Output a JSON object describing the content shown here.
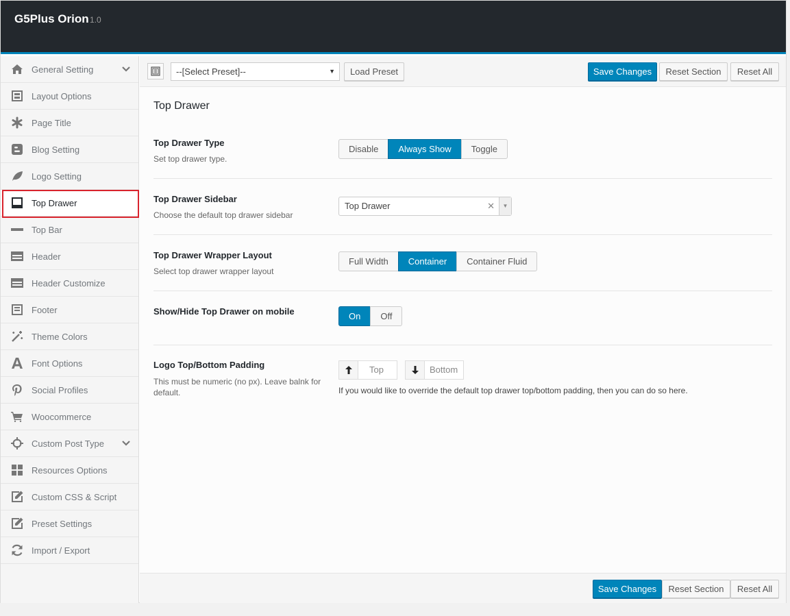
{
  "app": {
    "title": "G5Plus Orion",
    "version": "1.0"
  },
  "sidebar": {
    "items": [
      {
        "label": "General Setting",
        "icon": "home-icon",
        "chevron": true
      },
      {
        "label": "Layout Options",
        "icon": "layout-icon"
      },
      {
        "label": "Page Title",
        "icon": "asterisk-icon"
      },
      {
        "label": "Blog Setting",
        "icon": "blogger-icon"
      },
      {
        "label": "Logo Setting",
        "icon": "leaf-icon"
      },
      {
        "label": "Top Drawer",
        "icon": "top-drawer-icon",
        "active": true
      },
      {
        "label": "Top Bar",
        "icon": "minus-icon"
      },
      {
        "label": "Header",
        "icon": "header-icon"
      },
      {
        "label": "Header Customize",
        "icon": "header-customize-icon"
      },
      {
        "label": "Footer",
        "icon": "footer-icon"
      },
      {
        "label": "Theme Colors",
        "icon": "magic-wand-icon"
      },
      {
        "label": "Font Options",
        "icon": "font-icon"
      },
      {
        "label": "Social Profiles",
        "icon": "pinterest-icon"
      },
      {
        "label": "Woocommerce",
        "icon": "cart-icon"
      },
      {
        "label": "Custom Post Type",
        "icon": "crosshair-icon",
        "chevron": true
      },
      {
        "label": "Resources Options",
        "icon": "grid-icon"
      },
      {
        "label": "Custom CSS & Script",
        "icon": "edit-icon"
      },
      {
        "label": "Preset Settings",
        "icon": "edit-icon"
      },
      {
        "label": "Import / Export",
        "icon": "refresh-icon"
      }
    ]
  },
  "toolbar": {
    "preset_placeholder": "--[Select Preset]--",
    "load_preset": "Load Preset",
    "save": "Save Changes",
    "reset_section": "Reset Section",
    "reset_all": "Reset All"
  },
  "section": {
    "title": "Top Drawer",
    "type": {
      "label": "Top Drawer Type",
      "desc": "Set top drawer type.",
      "options": [
        "Disable",
        "Always Show",
        "Toggle"
      ],
      "selected": "Always Show"
    },
    "sidebar": {
      "label": "Top Drawer Sidebar",
      "desc": "Choose the default top drawer sidebar",
      "value": "Top Drawer"
    },
    "wrapper": {
      "label": "Top Drawer Wrapper Layout",
      "desc": "Select top drawer wrapper layout",
      "options": [
        "Full Width",
        "Container",
        "Container Fluid"
      ],
      "selected": "Container"
    },
    "mobile": {
      "label": "Show/Hide Top Drawer on mobile",
      "options": [
        "On",
        "Off"
      ],
      "selected": "On"
    },
    "padding": {
      "label": "Logo Top/Bottom Padding",
      "desc": "This must be numeric (no px). Leave balnk for default.",
      "top_placeholder": "Top",
      "bottom_placeholder": "Bottom",
      "note": "If you would like to override the default top drawer top/bottom padding, then you can do so here."
    }
  },
  "footer": {
    "save": "Save Changes",
    "reset_section": "Reset Section",
    "reset_all": "Reset All"
  },
  "colors": {
    "accent": "#0085ba",
    "topbar": "#23282d",
    "highlight": "#d9232d"
  }
}
